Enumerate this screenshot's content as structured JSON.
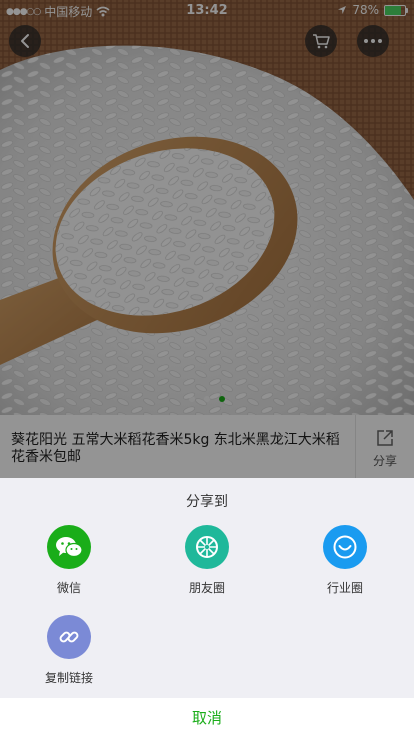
{
  "status_bar": {
    "carrier": "中国移动",
    "time": "13:42",
    "battery_percent": "78%",
    "battery_level": 0.78,
    "battery_color": "#4cd964",
    "icons": [
      "signal-icon",
      "wifi-icon",
      "location-arrow-icon",
      "battery-icon"
    ]
  },
  "nav": {
    "icons": [
      "back-arrow-icon",
      "cart-icon",
      "more-dots-icon"
    ]
  },
  "gallery": {
    "page_count": 3,
    "active_index": 2,
    "active_dot_color": "#1aad19"
  },
  "product": {
    "title": "葵花阳光 五常大米稻花香米5kg 东北米黑龙江大米稻花香米包邮",
    "share_label": "分享",
    "share_icon": "share-out-icon"
  },
  "share_sheet": {
    "title": "分享到",
    "options": [
      {
        "label": "微信",
        "icon": "wechat-icon",
        "color": "#1aad19"
      },
      {
        "label": "朋友圈",
        "icon": "moments-icon",
        "color": "#1fb89a"
      },
      {
        "label": "行业圈",
        "icon": "industry-circle-icon",
        "color": "#1a9bf0"
      },
      {
        "label": "复制链接",
        "icon": "link-icon",
        "color": "#7b8ad6"
      }
    ],
    "cancel_label": "取消",
    "accent_color": "#1aad19"
  }
}
